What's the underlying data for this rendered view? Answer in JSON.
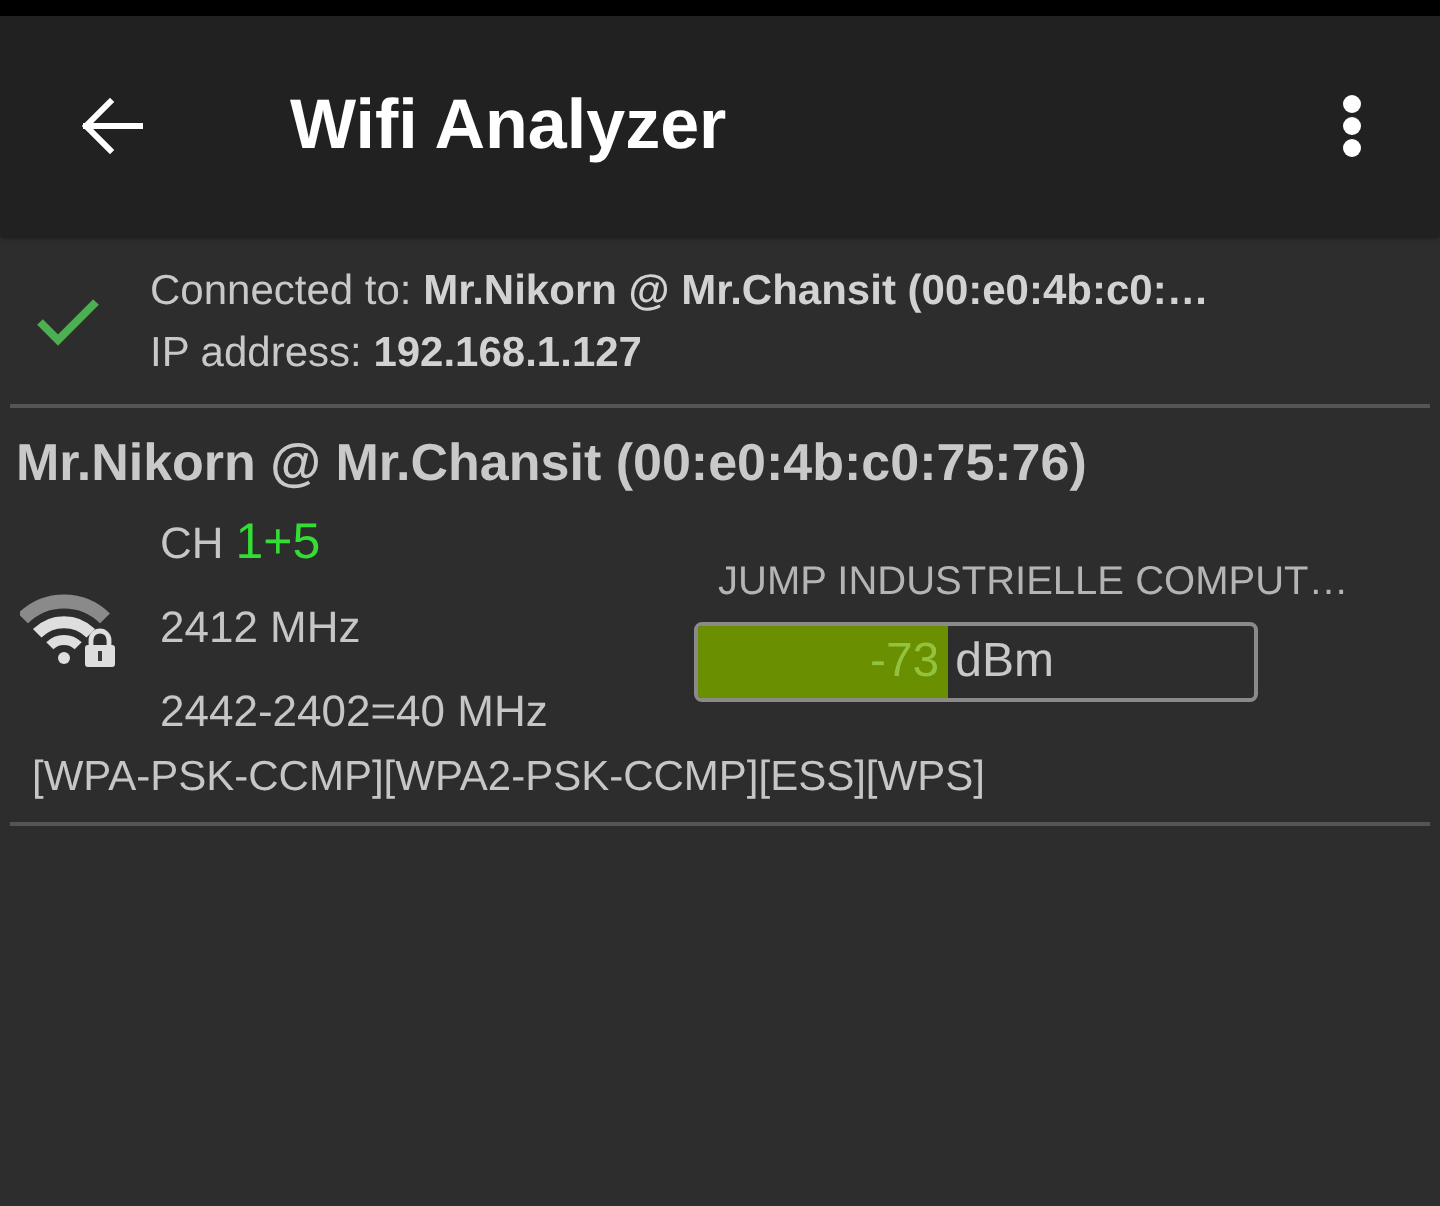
{
  "app_bar": {
    "title": "Wifi Analyzer"
  },
  "connection": {
    "connected": true,
    "text": "Connected to: **Mr.Nikorn @ Mr.Chansit (00:e0:4b:c0:…**",
    "ip_text": "IP address: **192.168.1.127**"
  },
  "networks": [
    {
      "name": "Mr.Nikorn @ Mr.Chansit (00:e0:4b:c0:75:76)",
      "channel_label": "CH",
      "channel": "1+5",
      "frequency": "2412 MHz",
      "bandwidth": "2442-2402=40 MHz",
      "vendor": "JUMP INDUSTRIELLE COMPUT…",
      "level": 0.45,
      "reading": "-73",
      "unit": "dBm",
      "secured": true,
      "capabilities": "[WPA-PSK-CCMP][WPA2-PSK-CCMP][ESS][WPS]"
    }
  ]
}
